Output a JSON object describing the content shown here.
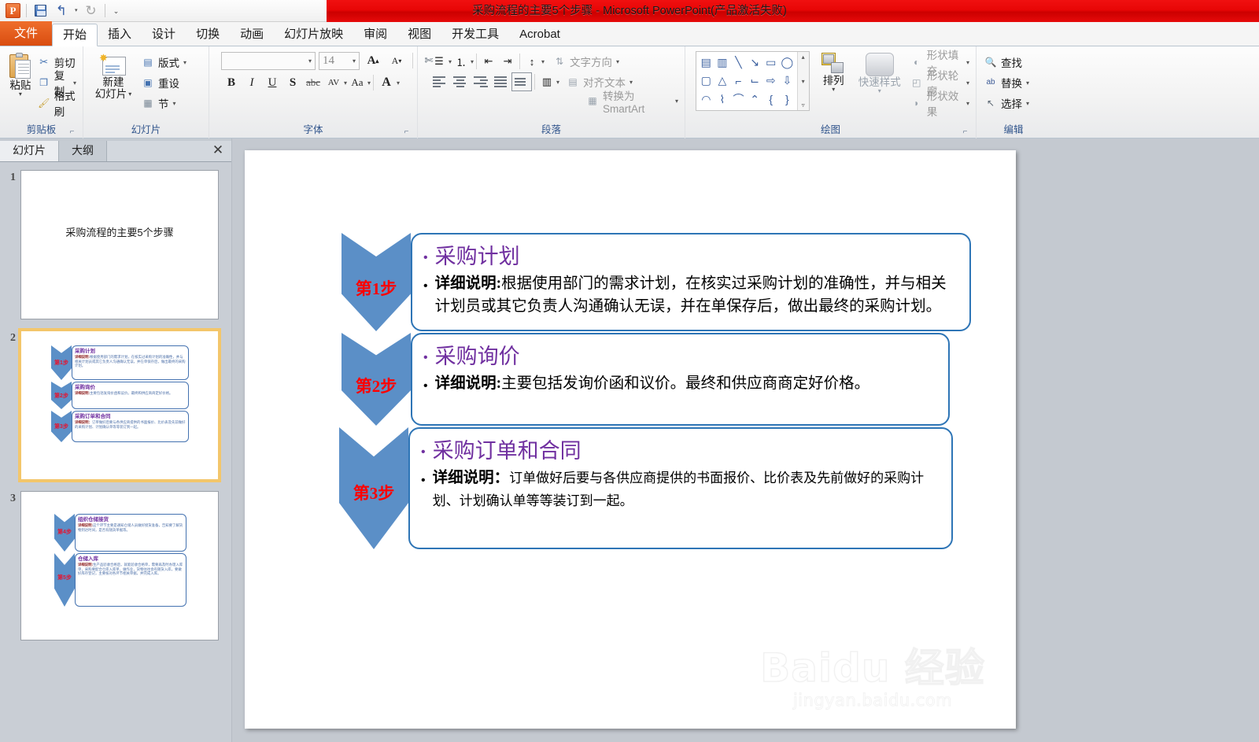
{
  "window": {
    "title": "采购流程的主要5个步骤 - Microsoft PowerPoint(产品激活失败)",
    "titlebar_color": "#e30000"
  },
  "qat": {
    "app_logo": "powerpoint-logo",
    "items": [
      {
        "name": "save-icon",
        "label": "保存"
      },
      {
        "name": "undo-icon",
        "label": "撤消"
      },
      {
        "name": "redo-icon",
        "label": "恢复"
      },
      {
        "name": "customize-qat-icon",
        "label": "自定义快速访问工具栏"
      }
    ]
  },
  "tabs": [
    {
      "label": "文件",
      "state": "file"
    },
    {
      "label": "开始",
      "state": "active"
    },
    {
      "label": "插入",
      "state": "normal"
    },
    {
      "label": "设计",
      "state": "normal"
    },
    {
      "label": "切换",
      "state": "normal"
    },
    {
      "label": "动画",
      "state": "normal"
    },
    {
      "label": "幻灯片放映",
      "state": "normal"
    },
    {
      "label": "审阅",
      "state": "normal"
    },
    {
      "label": "视图",
      "state": "normal"
    },
    {
      "label": "开发工具",
      "state": "normal"
    },
    {
      "label": "Acrobat",
      "state": "normal"
    }
  ],
  "ribbon": {
    "clipboard": {
      "title": "剪贴板",
      "paste": "粘贴",
      "cut": "剪切",
      "copy": "复制",
      "format_painter": "格式刷"
    },
    "slides": {
      "title": "幻灯片",
      "new_slide": "新建\n幻灯片",
      "new_slide_line1": "新建",
      "new_slide_line2": "幻灯片",
      "layout": "版式",
      "reset": "重设",
      "section": "节"
    },
    "font": {
      "title": "字体",
      "font_name": "",
      "font_name_placeholder": "",
      "font_size": "14",
      "bold": "B",
      "italic": "I",
      "underline": "U",
      "shadow": "S",
      "strikethrough": "abc",
      "char_spacing": "AV",
      "change_case": "Aa",
      "font_color": "A",
      "grow_font": "A",
      "shrink_font": "A",
      "clear_format": "清除所有格式"
    },
    "paragraph": {
      "title": "段落",
      "text_direction": "文字方向",
      "align_text": "对齐文本",
      "smartart": "转换为 SmartArt"
    },
    "drawing": {
      "title": "绘图",
      "arrange": "排列",
      "quick_styles": "快速样式",
      "shape_fill": "形状填充",
      "shape_outline": "形状轮廓",
      "shape_effects": "形状效果",
      "shape_glyphs": [
        "▤",
        "▥",
        "╲",
        "↘",
        "▭",
        "◯",
        "▢",
        "△",
        "⌐",
        "⌐",
        "⇨",
        "⇩",
        "◠",
        "⌇",
        "⌒",
        "⌃",
        "{",
        "}"
      ]
    },
    "editing": {
      "title": "编辑",
      "find": "查找",
      "replace": "替换",
      "select": "选择"
    }
  },
  "left_pane": {
    "tabs": [
      {
        "label": "幻灯片",
        "active": true
      },
      {
        "label": "大纲",
        "active": false
      }
    ],
    "close_label": "✕",
    "slides": [
      {
        "number": "1",
        "selected": false,
        "type": "title",
        "title": "采购流程的主要5个步骤"
      },
      {
        "number": "2",
        "selected": true,
        "type": "steps",
        "steps": [
          {
            "badge": "第1步",
            "heading": "采购计划",
            "label": "详细说明:",
            "body": "根据使用部门的需求计划，在核实过采购计划的准确性，并与相关计划员或其它负责人沟通确认无误，并在单保存后，做出最终的采购计划。"
          },
          {
            "badge": "第2步",
            "heading": "采购询价",
            "label": "详细说明:",
            "body": "主要包括发询价函和议价。最终和供应商商定好价格。"
          },
          {
            "badge": "第3步",
            "heading": "采购订单和合同",
            "label": "详细说明：",
            "body": "订单做好后要与各供应商提供的书面报价、比价表及先前做好的采购计划、计划确认单等等装订到一起。"
          }
        ]
      },
      {
        "number": "3",
        "selected": false,
        "type": "steps",
        "steps": [
          {
            "badge": "第4步",
            "heading": "组织仓储接货",
            "label": "详细说明:",
            "body": "这个环节主要是通知仓储人员做好接货准备，告知要了解货物到达时间，是否有随货单据等。"
          },
          {
            "badge": "第5步",
            "heading": "仓储入库",
            "label": "详细说明:",
            "body": "生产品验收合格后，就能验收合格单，需要再及时办理入库单，采购要配合仓库入库单，做作业，货物往往会有随货入库，要做好库存登记，主要核对各环节相关单据，并完成入库。"
          }
        ]
      }
    ]
  },
  "slide": {
    "steps": [
      {
        "badge": "第1步",
        "heading": "采购计划",
        "label": "详细说明:",
        "body": "根据使用部门的需求计划，在核实过采购计划的准确性，并与相关计划员或其它负责人沟通确认无误，并在单保存后，做出最终的采购计划。"
      },
      {
        "badge": "第2步",
        "heading": "采购询价",
        "label": "详细说明:",
        "body": "主要包括发询价函和议价。最终和供应商商定好价格。"
      },
      {
        "badge": "第3步",
        "heading": "采购订单和合同",
        "label": "详细说明：",
        "body": "订单做好后要与各供应商提供的书面报价、比价表及先前做好的采购计划、计划确认单等等装订到一起。"
      }
    ],
    "colors": {
      "chevron": "#5b8fc7",
      "badge_text": "#ff0000",
      "heading": "#7030a0",
      "card_border": "#2e75b6"
    }
  },
  "watermark": {
    "main": "Baidu 经验",
    "sub": "jingyan.baidu.com"
  }
}
